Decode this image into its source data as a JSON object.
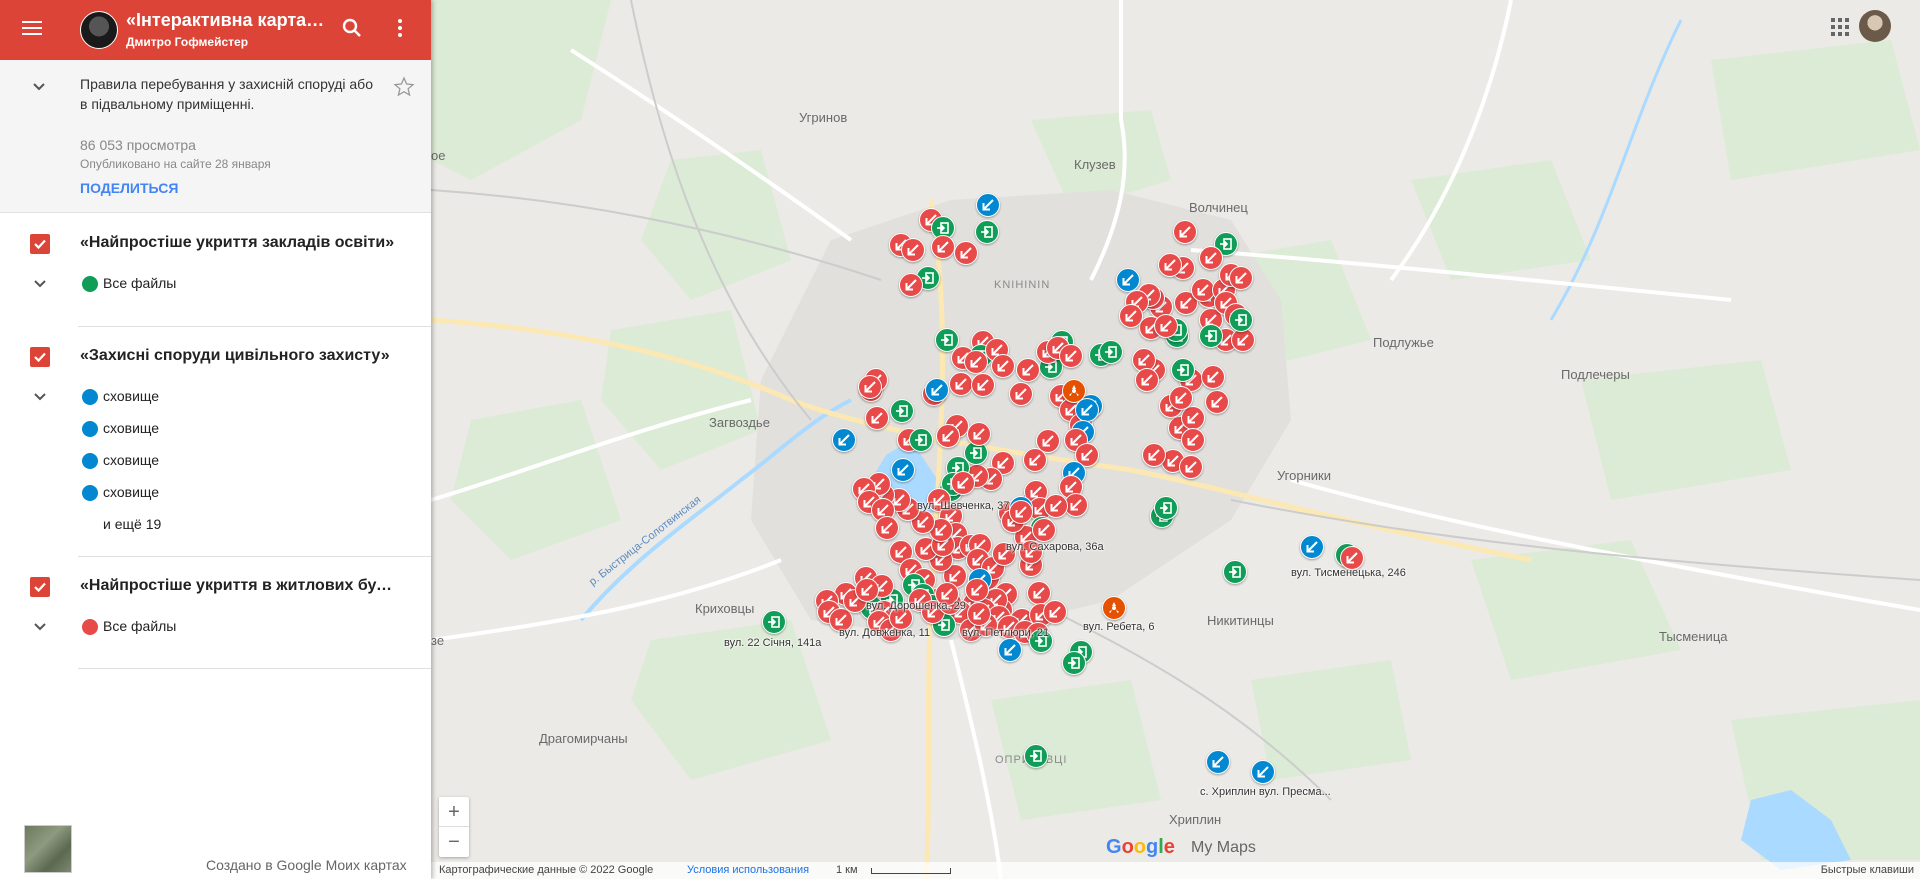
{
  "header": {
    "title": "«Інтерактивна карта найпростіших укриттів»",
    "author": "Дмитро Гофмейстер"
  },
  "description": {
    "text": "Правила перебування у захисній споруді або в підвальному приміщенні.",
    "views": "86 053 просмотра",
    "published": "Опубликовано на сайте 28 января",
    "share_label": "ПОДЕЛИТЬСЯ"
  },
  "layers": [
    {
      "title": "«Найпростіше укриття закладів освіти»",
      "items": [
        {
          "label": "Все файлы",
          "icon": "green-enter-icon",
          "color": "#0f9d58"
        }
      ]
    },
    {
      "title": "«Захисні споруди цивільного захисту»",
      "items": [
        {
          "label": "сховище",
          "icon": "blue-arrow-icon",
          "color": "#0288d1"
        },
        {
          "label": "сховище",
          "icon": "blue-arrow-icon",
          "color": "#0288d1"
        },
        {
          "label": "сховище",
          "icon": "blue-arrow-icon",
          "color": "#0288d1"
        },
        {
          "label": "сховище",
          "icon": "blue-arrow-icon",
          "color": "#0288d1"
        }
      ],
      "more": "и ещё 19"
    },
    {
      "title": "«Найпростіше укриття в житлових будинках»",
      "items": [
        {
          "label": "Все файлы",
          "icon": "red-arrow-icon",
          "color": "#e84a4a"
        }
      ]
    }
  ],
  "footer": {
    "created": "Создано в Google Моих картах"
  },
  "map": {
    "places": [
      "Угринов",
      "Клузев",
      "Волчинец",
      "KNIHININ",
      "Подлужье",
      "Подлечеры",
      "Загвоздье",
      "Угорники",
      "Криховцы",
      "Никитинцы",
      "Тысменица",
      "Драгомирчаны",
      "ОПРИШІВЦІ",
      "Хриплин",
      "р. Быстрица-Солотвинская",
      "ое",
      "зе"
    ],
    "addresses": [
      "вул. Шевченка, 37",
      "вул. Сахарова, 36а",
      "вул. Дорошенка, 29",
      "вул. Довженка, 11",
      "вул. Петлюри, 21",
      "вул. Ребета, 6",
      "вул. 22 Січня, 141а",
      "вул. Тисменецька, 246",
      "с. Хриплин вул. Пресма..."
    ],
    "copyright": "Картографические данные © 2022 Google",
    "terms": "Условия использования",
    "scale": "1 км",
    "shortcuts": "Быстрые клавиши",
    "logo": "Google",
    "logo_suffix": "My Maps",
    "zoom_in": "+",
    "zoom_out": "−",
    "colors": {
      "red": "#e84a4a",
      "green": "#0f9d58",
      "blue": "#0288d1",
      "orange": "#e65100"
    }
  }
}
